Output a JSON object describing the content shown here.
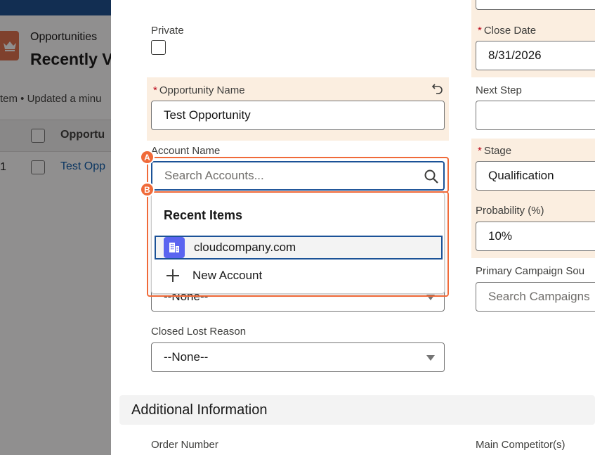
{
  "background": {
    "object_label": "Opportunities",
    "list_title": "Recently V",
    "meta": "tem • Updated a minu",
    "column_header": "Opportu",
    "row_number": "1",
    "row_link": "Test Opp"
  },
  "form": {
    "private": {
      "label": "Private"
    },
    "opportunity_name": {
      "label": "Opportunity Name",
      "required_mark": "*",
      "value": "Test Opportunity"
    },
    "account_name": {
      "label": "Account Name",
      "placeholder": "Search Accounts..."
    },
    "closed_lost_reason": {
      "label": "Closed Lost Reason",
      "value": "--None--"
    },
    "hidden_select": {
      "value": "--None--"
    },
    "close_date": {
      "label": "Close Date",
      "required_mark": "*",
      "value": "8/31/2026"
    },
    "next_step": {
      "label": "Next Step",
      "value": ""
    },
    "stage": {
      "label": "Stage",
      "required_mark": "*",
      "value": "Qualification"
    },
    "probability": {
      "label": "Probability (%)",
      "value": "10%"
    },
    "primary_campaign": {
      "label": "Primary Campaign Sou",
      "placeholder": "Search Campaigns"
    },
    "section_additional": "Additional Information",
    "order_number": {
      "label": "Order Number"
    },
    "main_competitor": {
      "label": "Main Competitor(s)"
    }
  },
  "dropdown": {
    "header": "Recent Items",
    "items": [
      {
        "label": "cloudcompany.com",
        "icon": "account-building-icon"
      }
    ],
    "new_account": "New Account"
  },
  "annotations": {
    "a": "A",
    "b": "B"
  },
  "colors": {
    "accent": "#f06a39",
    "focus": "#1b5297",
    "required": "#ba0517",
    "highlight": "#fbeee0"
  }
}
